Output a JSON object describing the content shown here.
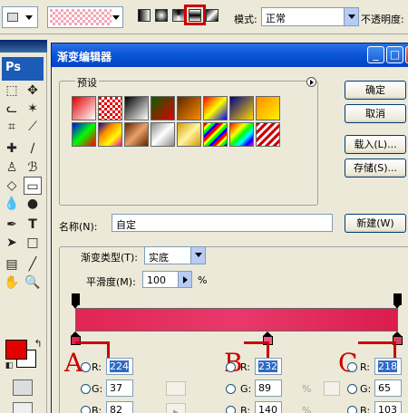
{
  "options_bar": {
    "mode_label": "模式:",
    "mode_value": "正常",
    "opacity_label": "不透明度:"
  },
  "tools": {
    "app_logo": "Ps",
    "foreground_color": "#e40000",
    "background_color": "#ffffff"
  },
  "dialog": {
    "title": "渐变编辑器",
    "presets_label": "预设",
    "buttons": {
      "ok": "确定",
      "cancel": "取消",
      "load": "载入(L)...",
      "save": "存储(S)...",
      "new": "新建(W)"
    },
    "name_label": "名称(N):",
    "name_value": "自定",
    "gradient_type_label": "渐变类型(T):",
    "gradient_type_value": "实底",
    "smoothness_label": "平滑度(M):",
    "smoothness_value": "100",
    "smoothness_unit": "%"
  },
  "color_stops": [
    {
      "marker": "A",
      "r": "224",
      "g": "37",
      "b": "82"
    },
    {
      "marker": "B",
      "r": "232",
      "g": "89",
      "b": "140"
    },
    {
      "marker": "C",
      "r": "218",
      "g": "65",
      "b": "103"
    }
  ],
  "channel_labels": {
    "r": "R:",
    "g": "G:",
    "b": "B:"
  },
  "percent_sign": "%"
}
